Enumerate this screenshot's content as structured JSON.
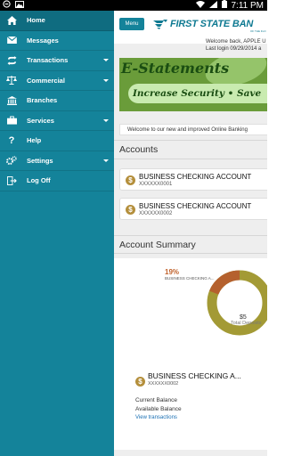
{
  "status_bar": {
    "time": "7:11 PM"
  },
  "nav": {
    "items": [
      {
        "label": "Home",
        "icon": "home-icon",
        "has_caret": false,
        "active": true
      },
      {
        "label": "Messages",
        "icon": "envelope-icon",
        "has_caret": false
      },
      {
        "label": "Transactions",
        "icon": "transfer-arrows-icon",
        "has_caret": true
      },
      {
        "label": "Commercial",
        "icon": "scales-icon",
        "has_caret": true
      },
      {
        "label": "Branches",
        "icon": "bank-building-icon",
        "has_caret": false
      },
      {
        "label": "Services",
        "icon": "briefcase-icon",
        "has_caret": true
      },
      {
        "label": "Help",
        "icon": "question-icon",
        "has_caret": false
      },
      {
        "label": "Settings",
        "icon": "gears-icon",
        "has_caret": true
      },
      {
        "label": "Log Off",
        "icon": "logout-icon",
        "has_caret": false
      }
    ]
  },
  "header": {
    "menu_label": "Menu",
    "bank_name": "FIRST STATE BAN",
    "bank_sub": "OF THE FLO",
    "welcome": "Welcome back, APPLE U",
    "last_login": "Last login 09/29/2014 a"
  },
  "banner": {
    "title": "E-Statements",
    "tagline": "Increase Security • Save"
  },
  "notice": "Welcome to our new and improved Online Banking",
  "accounts": {
    "title": "Accounts",
    "items": [
      {
        "name": "BUSINESS CHECKING ACCOUNT",
        "number": "XXXXXX0001"
      },
      {
        "name": "BUSINESS CHECKING ACCOUNT",
        "number": "XXXXXX0002"
      }
    ]
  },
  "summary": {
    "title": "Account Summary",
    "percent": "19%",
    "percent_label": "BUSINESS CHECKING A...",
    "donut_fraction": 0.19,
    "total_amount": "$5",
    "total_label": "Total Deposits",
    "account_name": "BUSINESS CHECKING A...",
    "account_number": "XXXXXX0002",
    "current_balance_label": "Current Balance",
    "available_balance_label": "Available Balance",
    "view_link": "View transactions"
  },
  "colors": {
    "nav_bg": "#14839a",
    "brand": "#0f7a92",
    "donut_gold": "#a39a35",
    "donut_orange": "#b5612e",
    "coin": "#b48f3c"
  }
}
